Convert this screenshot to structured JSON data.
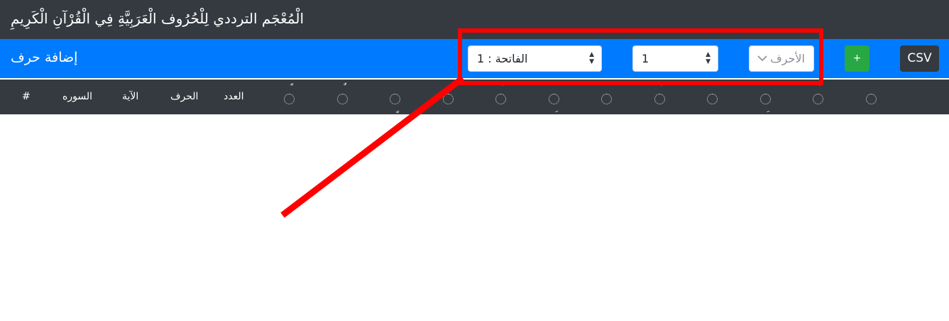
{
  "app": {
    "title": "الْمُعْجَم الترددي لِلْحُرُوف الْعَرَبِيَّةِ فِي الْقُرْآنِ الْكَرِيمِ"
  },
  "toolbar": {
    "add_letter_label": "إضافة حرف",
    "surah_select_value": "الفاتحة : 1",
    "ayah_select_value": "1",
    "letters_placeholder": "الأحرف",
    "add_button_label": "+",
    "csv_button_label": "CSV"
  },
  "table": {
    "headers": {
      "index": "#",
      "surah": "السوره",
      "ayah": "الآية",
      "letter": "الحرف",
      "count": "العدد"
    },
    "diacritic_columns": [
      "ـ",
      "ـَّ",
      "ـِّ",
      "ـًّ",
      "ـُّ",
      "ـْ",
      "ـِ",
      "ـَ",
      "ـٍ",
      "ـٌ",
      "ـً"
    ]
  },
  "colors": {
    "titlebar": "#343a40",
    "toolbar": "#007bff",
    "add_button": "#28a745",
    "csv_button": "#343a40",
    "annotation": "#ff0000"
  }
}
